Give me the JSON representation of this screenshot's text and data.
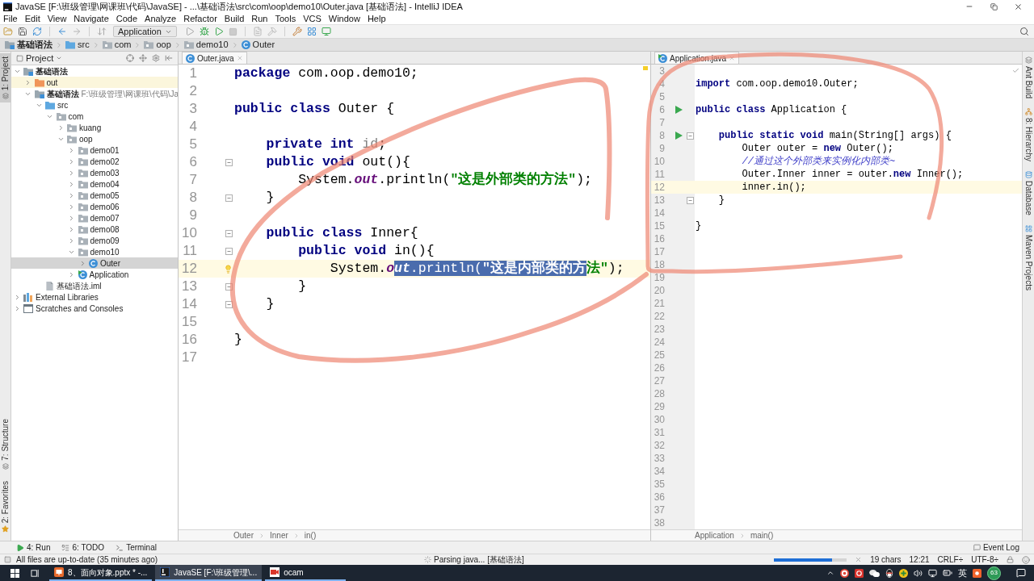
{
  "window": {
    "title": "JavaSE [F:\\班级管理\\网课班\\代码\\JavaSE] - ...\\基础语法\\src\\com\\oop\\demo10\\Outer.java [基础语法] - IntelliJ IDEA"
  },
  "menu": [
    "File",
    "Edit",
    "View",
    "Navigate",
    "Code",
    "Analyze",
    "Refactor",
    "Build",
    "Run",
    "Tools",
    "VCS",
    "Window",
    "Help"
  ],
  "toolbar": {
    "run_configuration": "Application"
  },
  "navigation_bar": [
    {
      "label": "基础语法",
      "kind": "module"
    },
    {
      "label": "src",
      "kind": "source-folder"
    },
    {
      "label": "com",
      "kind": "package"
    },
    {
      "label": "oop",
      "kind": "package"
    },
    {
      "label": "demo10",
      "kind": "package"
    },
    {
      "label": "Outer",
      "kind": "class"
    }
  ],
  "left_tool_strip": [
    {
      "label": "1: Project",
      "selected": true
    },
    {
      "label": "7: Structure",
      "selected": false
    },
    {
      "label": "2: Favorites",
      "selected": false
    }
  ],
  "project_panel": {
    "title": "Project",
    "tree": [
      {
        "label": "基础语法",
        "kind": "module",
        "expanded": true,
        "selected": false,
        "children": [
          {
            "label": "out",
            "kind": "excluded-folder",
            "expanded": false,
            "selected": false
          },
          {
            "label": "基础语法",
            "path": "F:\\班级管理\\网课班\\代码\\Ja",
            "kind": "module",
            "expanded": true,
            "selected": false,
            "children": [
              {
                "label": "src",
                "kind": "source-folder",
                "expanded": true,
                "selected": false,
                "children": [
                  {
                    "label": "com",
                    "kind": "package",
                    "expanded": true,
                    "selected": false,
                    "children": [
                      {
                        "label": "kuang",
                        "kind": "package",
                        "expanded": false,
                        "selected": false
                      },
                      {
                        "label": "oop",
                        "kind": "package",
                        "expanded": true,
                        "selected": false,
                        "children": [
                          {
                            "label": "demo01",
                            "kind": "package",
                            "expanded": false,
                            "selected": false
                          },
                          {
                            "label": "demo02",
                            "kind": "package",
                            "expanded": false,
                            "selected": false
                          },
                          {
                            "label": "demo03",
                            "kind": "package",
                            "expanded": false,
                            "selected": false
                          },
                          {
                            "label": "demo04",
                            "kind": "package",
                            "expanded": false,
                            "selected": false
                          },
                          {
                            "label": "demo05",
                            "kind": "package",
                            "expanded": false,
                            "selected": false
                          },
                          {
                            "label": "demo06",
                            "kind": "package",
                            "expanded": false,
                            "selected": false
                          },
                          {
                            "label": "demo07",
                            "kind": "package",
                            "expanded": false,
                            "selected": false
                          },
                          {
                            "label": "demo08",
                            "kind": "package",
                            "expanded": false,
                            "selected": false
                          },
                          {
                            "label": "demo09",
                            "kind": "package",
                            "expanded": false,
                            "selected": false
                          },
                          {
                            "label": "demo10",
                            "kind": "package",
                            "expanded": true,
                            "selected": false,
                            "children": [
                              {
                                "label": "Outer",
                                "kind": "class",
                                "expanded": false,
                                "selected": true
                              }
                            ]
                          },
                          {
                            "label": "Application",
                            "kind": "main-class",
                            "expanded": false,
                            "selected": false
                          }
                        ]
                      }
                    ]
                  }
                ]
              },
              {
                "label": "基础语法.iml",
                "kind": "iml",
                "selected": false
              }
            ]
          }
        ]
      },
      {
        "label": "External Libraries",
        "kind": "libraries",
        "expanded": false,
        "selected": false
      },
      {
        "label": "Scratches and Consoles",
        "kind": "scratches",
        "expanded": false,
        "selected": false
      }
    ]
  },
  "editors": [
    {
      "tabs": [
        {
          "label": "Outer.java",
          "kind": "class",
          "selected": true
        }
      ],
      "lines": [
        {
          "number": "1",
          "current": false,
          "tokens": [
            {
              "kind": "keyword",
              "text": "package"
            },
            {
              "kind": "plain",
              "text": " com.oop.demo10;"
            }
          ]
        },
        {
          "number": "2",
          "current": false
        },
        {
          "number": "3",
          "current": false,
          "tokens": [
            {
              "kind": "keyword",
              "text": "public class"
            },
            {
              "kind": "plain",
              "text": " Outer {"
            }
          ]
        },
        {
          "number": "4",
          "current": false
        },
        {
          "number": "5",
          "current": false,
          "tokens": [
            {
              "kind": "keyword",
              "text": "    private int "
            },
            {
              "kind": "unused",
              "text": "id"
            },
            {
              "kind": "plain",
              "text": ";"
            }
          ]
        },
        {
          "number": "6",
          "current": false,
          "markers": [
            {
              "kind": "fold"
            }
          ],
          "tokens": [
            {
              "kind": "keyword",
              "text": "    public void"
            },
            {
              "kind": "plain",
              "text": " out(){"
            }
          ]
        },
        {
          "number": "7",
          "current": false,
          "tokens": [
            {
              "kind": "plain",
              "text": "        System."
            },
            {
              "kind": "static",
              "text": "out"
            },
            {
              "kind": "plain",
              "text": ".println("
            },
            {
              "kind": "string",
              "text": "\"这是外部类的方法\""
            },
            {
              "kind": "plain",
              "text": ");"
            }
          ]
        },
        {
          "number": "8",
          "current": false,
          "markers": [
            {
              "kind": "fold"
            }
          ],
          "tokens": [
            {
              "kind": "plain",
              "text": "    }"
            }
          ]
        },
        {
          "number": "9",
          "current": false
        },
        {
          "number": "10",
          "current": false,
          "markers": [
            {
              "kind": "fold"
            }
          ],
          "tokens": [
            {
              "kind": "keyword",
              "text": "    public class"
            },
            {
              "kind": "plain",
              "text": " Inner{"
            }
          ]
        },
        {
          "number": "11",
          "current": false,
          "markers": [
            {
              "kind": "fold"
            }
          ],
          "tokens": [
            {
              "kind": "keyword",
              "text": "        public void"
            },
            {
              "kind": "plain",
              "text": " in(){"
            }
          ]
        },
        {
          "number": "12",
          "current": true,
          "markers": [
            {
              "kind": "bulb"
            }
          ],
          "tokens": [
            {
              "kind": "plain",
              "text": "            System.",
              "selected": false
            },
            {
              "kind": "static",
              "text": "o",
              "selected": false
            },
            {
              "kind": "static",
              "text": "ut",
              "selected": true
            },
            {
              "kind": "plain",
              "text": ".println(",
              "selected": true
            },
            {
              "kind": "string",
              "text": "\"这是内部类的方",
              "selected": true
            },
            {
              "kind": "string",
              "text": "法\"",
              "selected": false
            },
            {
              "kind": "plain",
              "text": ");",
              "selected": false
            }
          ]
        },
        {
          "number": "13",
          "current": false,
          "markers": [
            {
              "kind": "fold"
            }
          ],
          "tokens": [
            {
              "kind": "plain",
              "text": "        }"
            }
          ]
        },
        {
          "number": "14",
          "current": false,
          "markers": [
            {
              "kind": "fold"
            }
          ],
          "tokens": [
            {
              "kind": "plain",
              "text": "    }"
            }
          ]
        },
        {
          "number": "15",
          "current": false
        },
        {
          "number": "16",
          "current": false,
          "tokens": [
            {
              "kind": "plain",
              "text": "}"
            }
          ]
        },
        {
          "number": "17",
          "current": false
        }
      ],
      "breadcrumbs": [
        "Outer",
        "Inner",
        "in()"
      ]
    },
    {
      "tabs": [
        {
          "label": "Application.java",
          "kind": "main-class",
          "selected": true
        }
      ],
      "lines": [
        {
          "number": "3",
          "current": false
        },
        {
          "number": "4",
          "current": false,
          "tokens": [
            {
              "kind": "keyword",
              "text": "import"
            },
            {
              "kind": "plain",
              "text": " com.oop.demo10.Outer;"
            }
          ]
        },
        {
          "number": "5",
          "current": false
        },
        {
          "number": "6",
          "current": false,
          "markers": [
            {
              "kind": "run"
            }
          ],
          "tokens": [
            {
              "kind": "keyword",
              "text": "public class"
            },
            {
              "kind": "plain",
              "text": " Application {"
            }
          ]
        },
        {
          "number": "7",
          "current": false
        },
        {
          "number": "8",
          "current": false,
          "markers": [
            {
              "kind": "run"
            },
            {
              "kind": "fold"
            }
          ],
          "tokens": [
            {
              "kind": "keyword",
              "text": "    public static void"
            },
            {
              "kind": "plain",
              "text": " main(String[] args) {"
            }
          ]
        },
        {
          "number": "9",
          "current": false,
          "tokens": [
            {
              "kind": "plain",
              "text": "        Outer outer = "
            },
            {
              "kind": "keyword",
              "text": "new"
            },
            {
              "kind": "plain",
              "text": " Outer();"
            }
          ]
        },
        {
          "number": "10",
          "current": false,
          "tokens": [
            {
              "kind": "comment",
              "text": "        //通过这个外部类来实例化内部类~"
            }
          ]
        },
        {
          "number": "11",
          "current": false,
          "tokens": [
            {
              "kind": "plain",
              "text": "        Outer.Inner inner = outer."
            },
            {
              "kind": "keyword",
              "text": "new"
            },
            {
              "kind": "plain",
              "text": " Inner();"
            }
          ]
        },
        {
          "number": "12",
          "current": true,
          "tokens": [
            {
              "kind": "plain",
              "text": "        inner.in();"
            }
          ]
        },
        {
          "number": "13",
          "current": false,
          "markers": [
            {
              "kind": "fold"
            }
          ],
          "tokens": [
            {
              "kind": "plain",
              "text": "    }"
            }
          ]
        },
        {
          "number": "14",
          "current": false
        },
        {
          "number": "15",
          "current": false,
          "tokens": [
            {
              "kind": "plain",
              "text": "}"
            }
          ]
        },
        {
          "number": "16",
          "current": false
        },
        {
          "number": "17",
          "current": false
        },
        {
          "number": "18",
          "current": false
        },
        {
          "number": "19",
          "current": false
        },
        {
          "number": "20",
          "current": false
        },
        {
          "number": "21",
          "current": false
        },
        {
          "number": "22",
          "current": false
        },
        {
          "number": "23",
          "current": false
        },
        {
          "number": "24",
          "current": false
        },
        {
          "number": "25",
          "current": false
        },
        {
          "number": "26",
          "current": false
        },
        {
          "number": "27",
          "current": false
        },
        {
          "number": "28",
          "current": false
        },
        {
          "number": "29",
          "current": false
        },
        {
          "number": "30",
          "current": false
        },
        {
          "number": "31",
          "current": false
        },
        {
          "number": "32",
          "current": false
        },
        {
          "number": "33",
          "current": false
        },
        {
          "number": "34",
          "current": false
        },
        {
          "number": "35",
          "current": false
        },
        {
          "number": "36",
          "current": false
        },
        {
          "number": "37",
          "current": false
        },
        {
          "number": "38",
          "current": false
        }
      ],
      "breadcrumbs": [
        "Application",
        "main()"
      ]
    }
  ],
  "right_tool_strip": [
    {
      "label": "Ant Build",
      "kind": "ant"
    },
    {
      "label": "8: Hierarchy",
      "kind": "hierarchy"
    },
    {
      "label": "Database",
      "kind": "database"
    },
    {
      "label": "Maven Projects",
      "kind": "maven"
    }
  ],
  "tool_windows": [
    {
      "label": "4: Run",
      "kind": "run"
    },
    {
      "label": "6: TODO",
      "kind": "todo"
    },
    {
      "label": "Terminal",
      "kind": "terminal"
    }
  ],
  "event_log": {
    "label": "Event Log"
  },
  "status_bar": {
    "message": "All files are up-to-date (35 minutes ago)",
    "task": "Parsing java... [基础语法]",
    "progress": {
      "level": 0.8
    },
    "selection": "19 chars",
    "position": "12:21",
    "line_separator": "CRLF÷",
    "encoding": "UTF-8÷"
  },
  "taskbar": {
    "tasks": [
      {
        "label": "8、面向对象.pptx * -...",
        "kind": "presentation",
        "selected": false
      },
      {
        "label": "JavaSE [F:\\班级管理\\...",
        "kind": "ide",
        "selected": true
      },
      {
        "label": "ocam",
        "kind": "recorder",
        "selected": false
      }
    ],
    "ime": "英",
    "indicator": "63"
  }
}
